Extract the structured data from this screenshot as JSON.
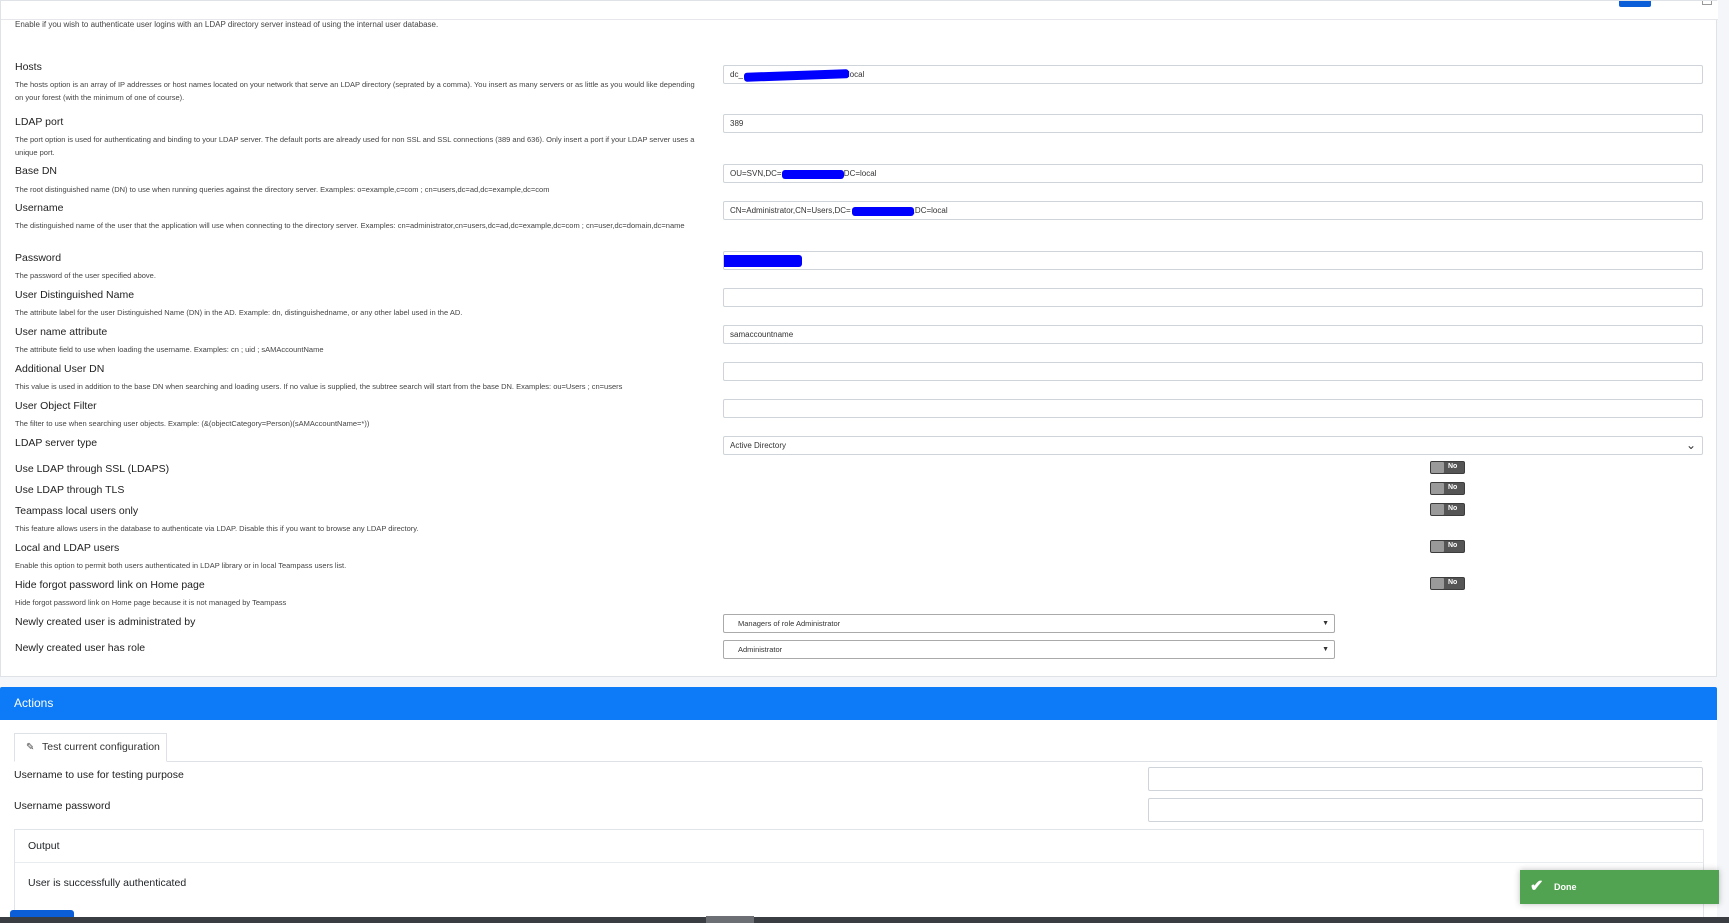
{
  "intro_text": "Enable if you wish to authenticate user logins with an LDAP directory server instead of using the internal user database.",
  "settings": {
    "hosts": {
      "label": "Hosts",
      "desc": "The hosts option is an array of IP addresses or host names located on your network that serve an LDAP directory (seprated by a comma). You insert as many servers or as little as you would like depending on your forest (with the minimum of one of course).",
      "value_prefix": "dc_",
      "value_suffix": "local"
    },
    "port": {
      "label": "LDAP port",
      "desc": "The port option is used for authenticating and binding to your LDAP server. The default ports are already used for non SSL and SSL connections (389 and 636). Only insert a port if your LDAP server uses a unique port.",
      "value": "389"
    },
    "base_dn": {
      "label": "Base DN",
      "desc": "The root distinguished name (DN) to use when running queries against the directory server. Examples: o=example,c=com ; cn=users,dc=ad,dc=example,dc=com",
      "value_prefix": "OU=SVN,DC=",
      "value_suffix": ",DC=local"
    },
    "username": {
      "label": "Username",
      "desc": "The distinguished name of the user that the application will use when connecting to the directory server. Examples: cn=administrator,cn=users,dc=ad,dc=example,dc=com ; cn=user,dc=domain,dc=name",
      "value_prefix": "CN=Administrator,CN=Users,DC=",
      "value_suffix": ",DC=local"
    },
    "password": {
      "label": "Password",
      "desc": "The password of the user specified above."
    },
    "user_dn": {
      "label": "User Distinguished Name",
      "desc": "The attribute label for the user Distinguished Name (DN) in the AD. Example: dn, distinguishedname, or any other label used in the AD.",
      "value": ""
    },
    "user_name_attr": {
      "label": "User name attribute",
      "desc": "The attribute field to use when loading the username. Examples: cn ; uid ; sAMAccountName",
      "value": "samaccountname"
    },
    "additional_dn": {
      "label": "Additional User DN",
      "desc": "This value is used in addition to the base DN when searching and loading users. If no value is supplied, the subtree search will start from the base DN. Examples: ou=Users ; cn=users",
      "value": ""
    },
    "user_filter": {
      "label": "User Object Filter",
      "desc": "The filter to use when searching user objects. Example: (&(objectCategory=Person)(sAMAccountName=*))",
      "value": ""
    },
    "server_type": {
      "label": "LDAP server type",
      "value": "Active Directory"
    },
    "ssl": {
      "label": "Use LDAP through SSL (LDAPS)",
      "state": "No"
    },
    "tls": {
      "label": "Use LDAP through TLS",
      "state": "No"
    },
    "local_only": {
      "label": "Teampass local users only",
      "desc": "This feature allows users in the database to authenticate via LDAP. Disable this if you want to browse any LDAP directory.",
      "state": "No"
    },
    "local_and_ldap": {
      "label": "Local and LDAP users",
      "desc": "Enable this option to permit both users authenticated in LDAP library or in local Teampass users list.",
      "state": "No"
    },
    "hide_forgot": {
      "label": "Hide forgot password link on Home page",
      "desc": "Hide forgot password link on Home page because it is not managed by Teampass",
      "state": "No"
    },
    "administered_by": {
      "label": "Newly created user is administrated by",
      "value": "Managers of role Administrator"
    },
    "user_role": {
      "label": "Newly created user has role",
      "value": "Administrator"
    }
  },
  "actions": {
    "title": "Actions",
    "tab_label": "Test current configuration",
    "test_username_label": "Username to use for testing purpose",
    "test_password_label": "Username password",
    "output_title": "Output",
    "output_message": "User is successfully authenticated"
  },
  "toast": {
    "text": "Done"
  },
  "colors": {
    "accent": "#0d7bf7",
    "success": "#51a351",
    "redaction": "#0000ff"
  }
}
